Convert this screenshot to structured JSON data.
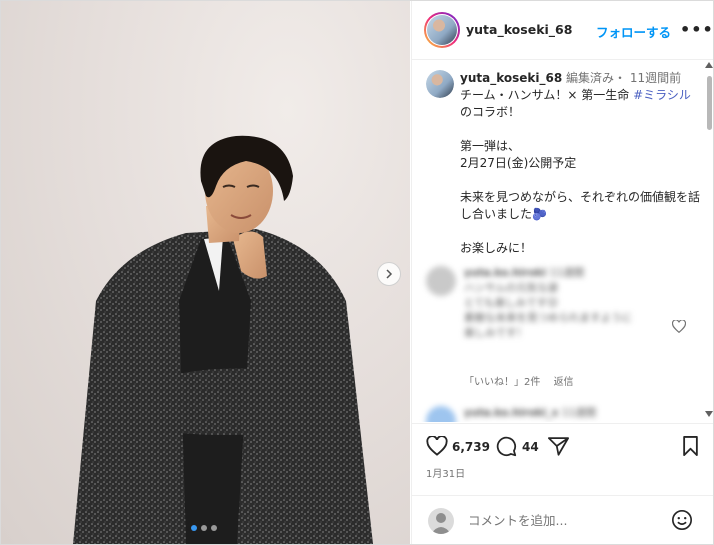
{
  "post": {
    "username": "yuta_koseki_68",
    "follow_label": "フォローする",
    "more_label": "•••"
  },
  "caption": {
    "username": "yuta_koseki_68",
    "edited": "編集済み・",
    "time": "11週間前",
    "line1_a": "チーム・ハンサム！× 第一生命 ",
    "line1_tag": "#ミラシル",
    "line1_b": " のコラボ！",
    "line2": "第一弾は、",
    "line3": "2月27日(金)公開予定",
    "line4": "未来を見つめながら、それぞれの価値観を話し合いました🫐",
    "line5": "お楽しみに！"
  },
  "comment": {
    "username": "yuta.ko.hiroki",
    "time": "11週間",
    "lines": [
      "ハンサムの元気な姿",
      "とても楽しみです😊",
      "素敵な未来を見つめられますように",
      "楽しみです！"
    ],
    "likes_label": "「いいね！」2件",
    "reply_label": "返信"
  },
  "comment2": {
    "username": "yuta.ko.hiroki_x",
    "time": "11週間"
  },
  "stats": {
    "likes": "6,739",
    "comments": "44"
  },
  "date": "1月31日",
  "add_comment": {
    "placeholder": "コメントを追加..."
  },
  "carousel": {
    "slides": 3,
    "active": 1
  },
  "colors": {
    "accent": "#0095f6",
    "hashtag": "#4a5fc1"
  }
}
